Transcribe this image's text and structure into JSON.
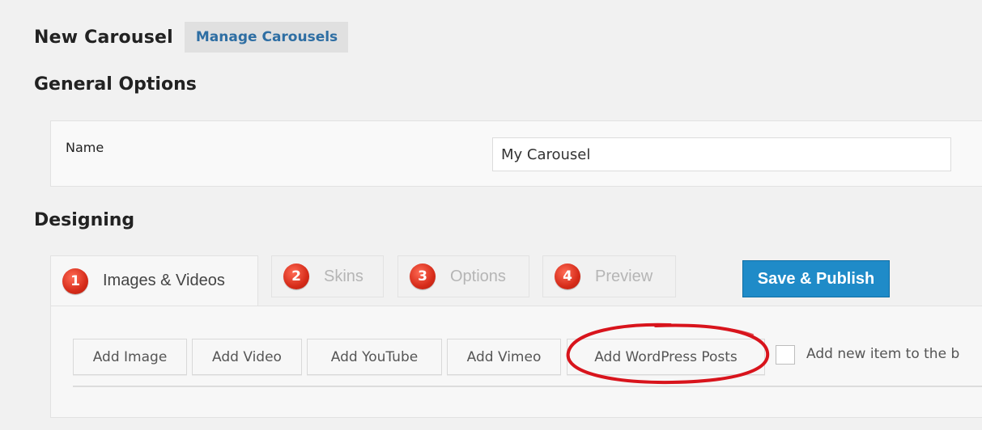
{
  "header": {
    "title": "New Carousel",
    "manage_link": "Manage Carousels"
  },
  "general": {
    "title": "General Options",
    "name_label": "Name",
    "name_value": "My Carousel"
  },
  "designing": {
    "title": "Designing",
    "tabs": [
      {
        "number": "1",
        "label": "Images & Videos",
        "active": true
      },
      {
        "number": "2",
        "label": "Skins",
        "active": false
      },
      {
        "number": "3",
        "label": "Options",
        "active": false
      },
      {
        "number": "4",
        "label": "Preview",
        "active": false
      }
    ],
    "save_label": "Save & Publish"
  },
  "content": {
    "buttons": {
      "add_image": "Add Image",
      "add_video": "Add Video",
      "add_youtube": "Add YouTube",
      "add_vimeo": "Add Vimeo",
      "add_wordpress_posts": "Add WordPress Posts"
    },
    "checkbox_label": "Add new item to the b",
    "checkbox_checked": false
  },
  "colors": {
    "accent_blue": "#1f8bc8",
    "link_blue": "#2e6ea3",
    "step_badge_red": "#d62c1a",
    "highlight_red": "#d8141c"
  },
  "icons": {
    "step_badge": "numbered-red-circle-icon"
  }
}
